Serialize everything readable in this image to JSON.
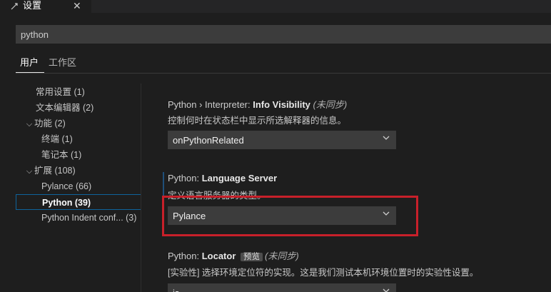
{
  "tab": {
    "title": "设置",
    "close": "✕"
  },
  "search": {
    "value": "python"
  },
  "scope_tabs": [
    {
      "label": "用户"
    },
    {
      "label": "工作区"
    }
  ],
  "toc": [
    {
      "label": "常用设置 (1)"
    },
    {
      "label": "文本编辑器 (2)"
    },
    {
      "label": "功能 (2)"
    },
    {
      "label": "终端 (1)"
    },
    {
      "label": "笔记本 (1)"
    },
    {
      "label": "扩展 (108)"
    },
    {
      "label": "Pylance (66)"
    },
    {
      "label": "Python (39)"
    },
    {
      "label": "Python Indent conf... (3)"
    }
  ],
  "settings": [
    {
      "category": "Python › Interpreter: ",
      "key": "Info Visibility",
      "note": "(未同步)",
      "description": "控制何时在状态栏中显示所选解释器的信息。",
      "value": "onPythonRelated"
    },
    {
      "category": "Python: ",
      "key": "Language Server",
      "description": "定义语言服务器的类型。",
      "value": "Pylance"
    },
    {
      "category": "Python: ",
      "key": "Locator",
      "badge": "预览",
      "note": "(未同步)",
      "description": "[实验性] 选择环境定位符的实现。这是我们测试本机环境位置时的实验性设置。",
      "value": "js"
    }
  ],
  "colors": {
    "highlight": "#c8202a",
    "selected_border": "#0e639c"
  }
}
